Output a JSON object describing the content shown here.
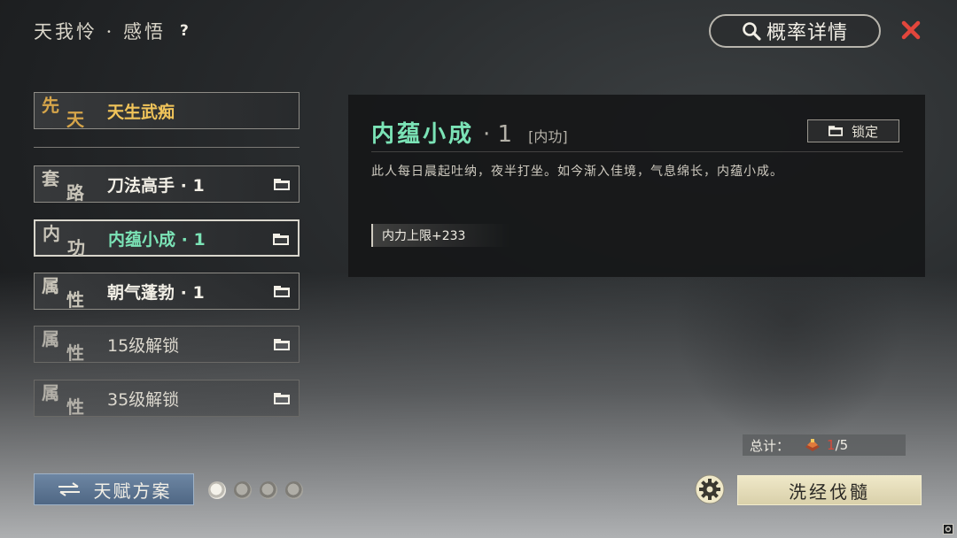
{
  "header": {
    "title": "天我怜 · 感悟",
    "help_icon": "question-icon",
    "help_label": "?"
  },
  "probability_button": {
    "label": "概率详情",
    "icon": "search-icon"
  },
  "close_button": {
    "icon": "close-icon",
    "color": "#e2463c"
  },
  "innate": {
    "tag": [
      "先",
      "天"
    ],
    "name": "天生武痴"
  },
  "slots": [
    {
      "tag": [
        "套",
        "路"
      ],
      "name": "刀法高手 · 1",
      "icon": "lock-icon"
    },
    {
      "tag": [
        "内",
        "功"
      ],
      "name": "内蕴小成 · 1",
      "icon": "lock-icon",
      "selected": true
    },
    {
      "tag": [
        "属",
        "性"
      ],
      "name": "朝气蓬勃 · 1",
      "icon": "lock-icon"
    },
    {
      "tag": [
        "属",
        "性"
      ],
      "name": "15级解锁",
      "icon": "lock-icon",
      "locked": true
    },
    {
      "tag": [
        "属",
        "性"
      ],
      "name": "35级解锁",
      "icon": "lock-icon",
      "locked": true
    }
  ],
  "detail": {
    "name": "内蕴小成",
    "level": "· 1",
    "type": "[内功]",
    "lock_button": "锁定",
    "description": "此人每日晨起吐纳，夜半打坐。如今渐入佳境，气息绵长，内蕴小成。",
    "attribute": "内力上限+233"
  },
  "total": {
    "label": "总计：",
    "current": "1",
    "max": "/5",
    "icon": "gem-icon"
  },
  "plan_button": {
    "label": "天赋方案",
    "icon": "swap-arrows-icon"
  },
  "pages": {
    "count": 4,
    "active": 1
  },
  "settings_button": {
    "icon": "gear-icon"
  },
  "wash_button": {
    "label": "洗经伐髓"
  },
  "colors": {
    "accent_green": "#7be3b6",
    "gold": "#f1c45a",
    "red": "#d84a3a"
  }
}
